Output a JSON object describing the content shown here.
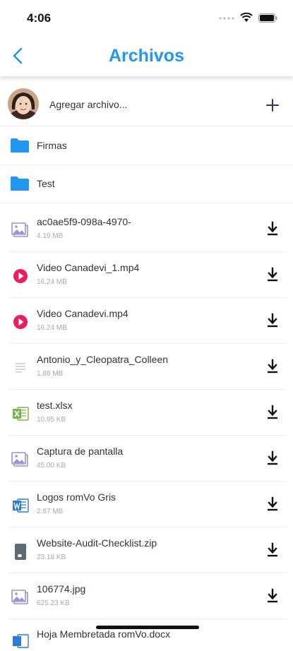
{
  "status": {
    "time": "4:06"
  },
  "nav": {
    "title": "Archivos"
  },
  "add": {
    "label": "Agregar archivo..."
  },
  "folders": [
    {
      "name": "Firmas"
    },
    {
      "name": "Test"
    }
  ],
  "files": [
    {
      "name": "ac0ae5f9-098a-4970-",
      "size": "4.19 MB",
      "icon": "image-icon"
    },
    {
      "name": "Video Canadevi_1.mp4",
      "size": "16.24 MB",
      "icon": "video-icon"
    },
    {
      "name": "Video Canadevi.mp4",
      "size": "16.24 MB",
      "icon": "video-icon"
    },
    {
      "name": "Antonio_y_Cleopatra_Colleen",
      "size": "1.88 MB",
      "icon": "document-icon"
    },
    {
      "name": "test.xlsx",
      "size": "10.95 KB",
      "icon": "excel-icon"
    },
    {
      "name": "Captura de pantalla",
      "size": "45.00 KB",
      "icon": "image-icon"
    },
    {
      "name": "Logos romVo Gris",
      "size": "2.87 MB",
      "icon": "word-icon"
    },
    {
      "name": "Website-Audit-Checklist.zip",
      "size": "23.18 KB",
      "icon": "zip-icon"
    },
    {
      "name": "106774.jpg",
      "size": "625.23 KB",
      "icon": "image-icon"
    }
  ],
  "partial_file": {
    "name": "Hoja Membretada romVo.docx"
  },
  "colors": {
    "accent": "#2196F3",
    "video": "#E91E63",
    "image": "#9C8FD6",
    "excel": "#7CB342",
    "word": "#2B7CD3"
  }
}
